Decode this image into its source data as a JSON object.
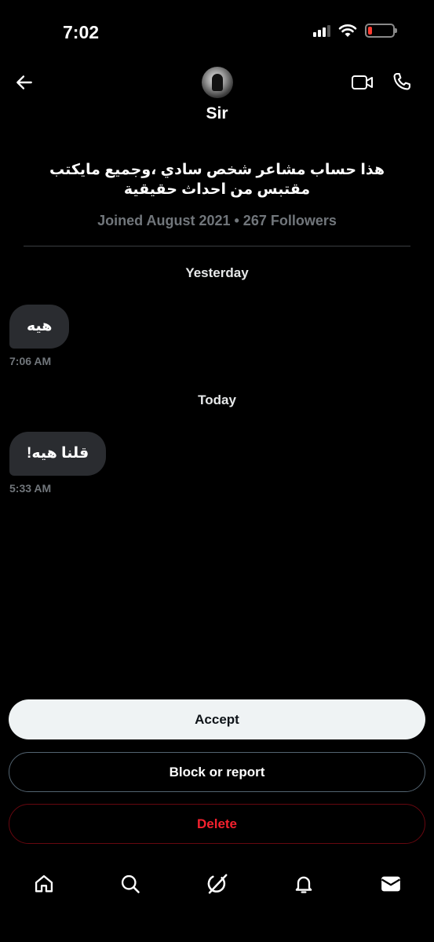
{
  "status_bar": {
    "time": "7:02",
    "battery_color": "#ff3b30"
  },
  "header": {
    "back_icon": "arrow-left-icon",
    "video_icon": "video-camera-icon",
    "call_icon": "phone-icon",
    "name": "Sir"
  },
  "profile": {
    "bio": "هذا حساب مشاعر شخص سادي ،وجميع مايكتب مقتبس من احداث حقيقية",
    "meta": "Joined August 2021 • 267 Followers"
  },
  "conversation": [
    {
      "day": "Yesterday",
      "text": "هيه",
      "time": "7:06 AM"
    },
    {
      "day": "Today",
      "text": "قلنا هيه!",
      "time": "5:33 AM"
    }
  ],
  "actions": {
    "accept": "Accept",
    "block": "Block or report",
    "delete": "Delete",
    "delete_color": "#f4212e"
  },
  "nav": [
    "home-icon",
    "search-icon",
    "grok-icon",
    "notifications-bell-icon",
    "messages-envelope-icon"
  ]
}
